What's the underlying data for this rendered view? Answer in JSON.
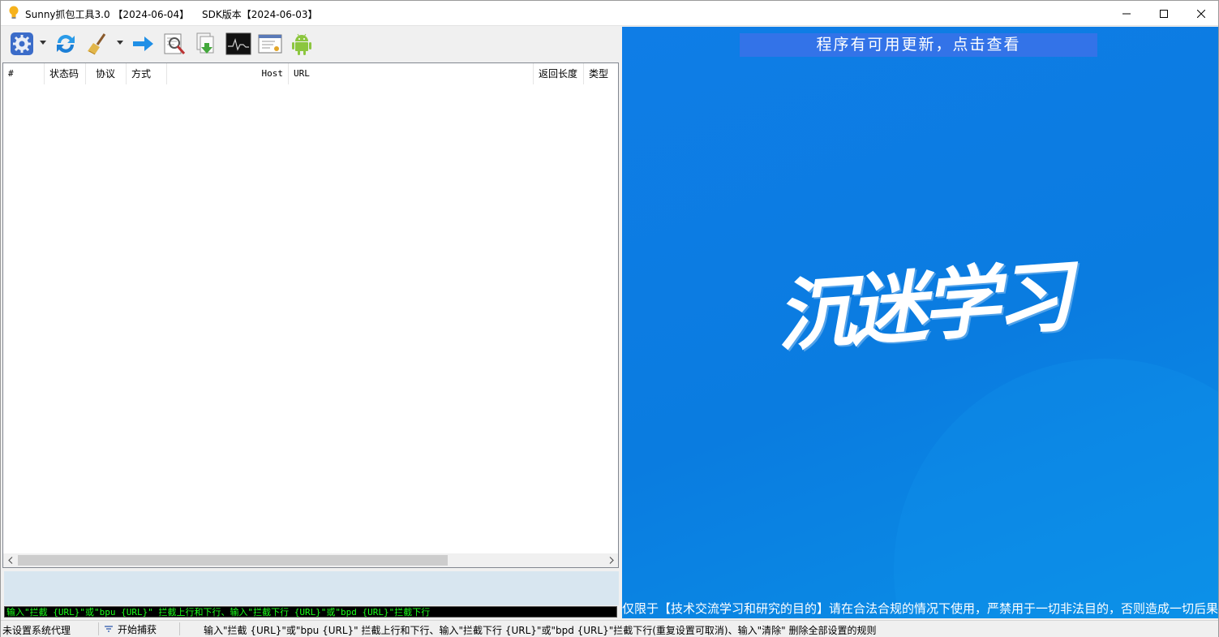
{
  "window": {
    "title": "Sunny抓包工具3.0 【2024-06-04】",
    "sdk_version": "SDK版本【2024-06-03】"
  },
  "toolbar": {
    "icons": [
      "settings-icon",
      "refresh-icon",
      "clear-broom-icon",
      "forward-arrow-icon",
      "inspect-magnifier-icon",
      "export-icon",
      "monitor-chart-icon",
      "certificate-icon",
      "android-icon"
    ]
  },
  "table": {
    "columns": {
      "num": "#",
      "status": "状态码",
      "protocol": "协议",
      "method": "方式",
      "host": "Host",
      "url": "URL",
      "length": "返回长度",
      "type": "类型"
    },
    "rows": []
  },
  "command": {
    "value": "输入\"拦截 {URL}\"或\"bpu {URL}\" 拦截上行和下行、输入\"拦截下行 {URL}\"或\"bpd {URL}\"拦截下行"
  },
  "statusbar": {
    "proxy": "未设置系统代理",
    "capture": "开始捕获",
    "hint": "输入\"拦截 {URL}\"或\"bpu {URL}\" 拦截上行和下行、输入\"拦截下行 {URL}\"或\"bpd {URL}\"拦截下行(重复设置可取消)、输入\"清除\" 删除全部设置的规则"
  },
  "right_panel": {
    "update_banner": "程序有可用更新，点击查看",
    "brand": "沉迷学习",
    "disclaimer": "仅限于【技术交流学习和研究的目的】请在合法合规的情况下使用，严禁用于一切非法目的，否则造成一切后果自负！"
  },
  "colors": {
    "panel_blue": "#0f7de6",
    "banner_blue": "#3373e8",
    "console_green": "#1aff1a"
  }
}
